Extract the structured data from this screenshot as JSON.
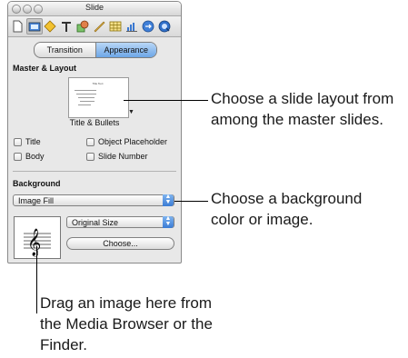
{
  "window": {
    "title": "Slide"
  },
  "toolbar": {
    "icons": [
      "document-inspector-icon",
      "slide-inspector-icon",
      "build-inspector-icon",
      "text-inspector-icon",
      "graphic-inspector-icon",
      "metrics-inspector-icon",
      "table-inspector-icon",
      "chart-inspector-icon",
      "hyperlink-inspector-icon",
      "quicktime-inspector-icon"
    ],
    "selected": "slide-inspector-icon"
  },
  "tabs": {
    "transition": "Transition",
    "appearance": "Appearance",
    "selected": "Appearance"
  },
  "master_layout": {
    "heading": "Master & Layout",
    "layout_name": "Title & Bullets",
    "thumbnail_title": "Title Text",
    "checkboxes": {
      "title": "Title",
      "body": "Body",
      "object_placeholder": "Object Placeholder",
      "slide_number": "Slide Number"
    }
  },
  "background": {
    "heading": "Background",
    "fill_popup": "Image Fill",
    "size_popup": "Original Size",
    "choose_button": "Choose..."
  },
  "callouts": {
    "layout_line1": "Choose a slide layout from",
    "layout_line2": "among the master slides.",
    "bg_line1": "Choose a background",
    "bg_line2": "color or image.",
    "drag_line1": "Drag an image here from",
    "drag_line2": "the Media Browser or the",
    "drag_line3": "Finder."
  },
  "colors": {
    "selection_blue": "#6da6e7",
    "panel_bg": "#e8e8e8"
  }
}
